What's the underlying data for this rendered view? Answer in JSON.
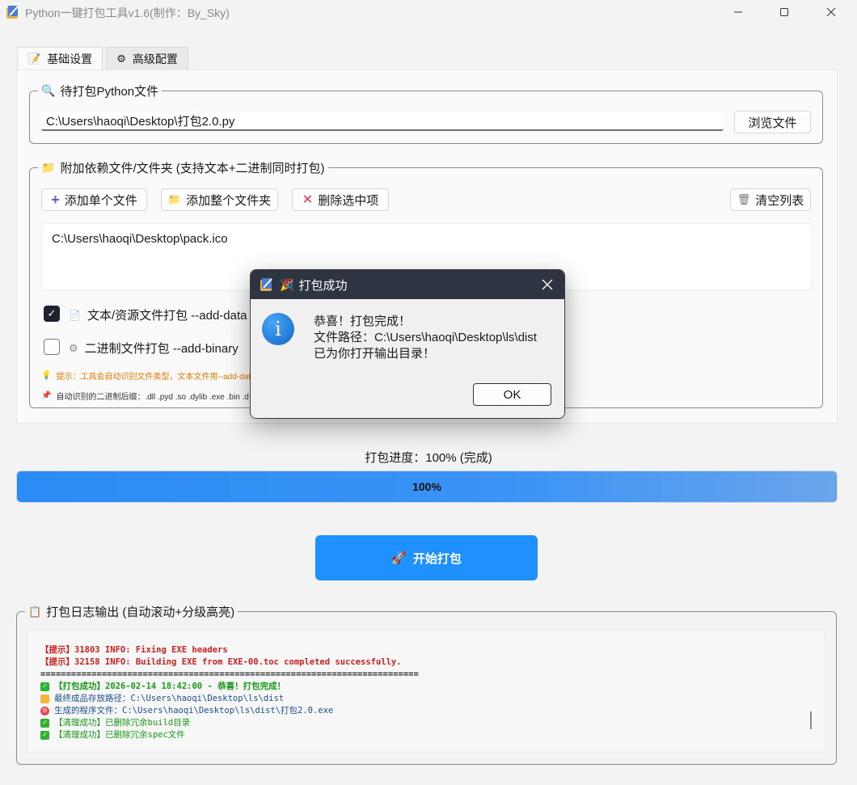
{
  "window": {
    "title": "Python一键打包工具v1.6(制作：By_Sky)",
    "minimize_icon": "minimize-icon",
    "maximize_icon": "maximize-icon",
    "close_icon": "close-icon"
  },
  "tabs": [
    {
      "label": "基础设置",
      "icon": "memo-icon",
      "active": true
    },
    {
      "label": "高级配置",
      "icon": "gear-icon",
      "active": false
    }
  ],
  "python_file": {
    "legend": "待打包Python文件",
    "path_value": "C:\\Users\\haoqi\\Desktop\\打包2.0.py",
    "browse_label": "浏览文件"
  },
  "deps": {
    "legend": "附加依赖文件/文件夹 (支持文本+二进制同时打包)",
    "add_file_label": "添加单个文件",
    "add_folder_label": "添加整个文件夹",
    "delete_label": "删除选中项",
    "clear_label": "清空列表",
    "files": [
      "C:\\Users\\haoqi\\Desktop\\pack.ico"
    ],
    "text_mode": {
      "label": "文本/资源文件打包 --add-data",
      "checked": true
    },
    "binary_mode": {
      "label": "二进制文件打包 --add-binary",
      "checked": false
    },
    "hint1": "提示：工具会自动识别文件类型，文本文件用--add-data",
    "hint2": "自动识别的二进制后缀：.dll .pyd .so .dylib .exe .bin .d"
  },
  "progress": {
    "label": "打包进度：100% (完成)",
    "value": 100,
    "text": "100%"
  },
  "start_button": {
    "label": "开始打包",
    "icon": "rocket-icon"
  },
  "log": {
    "legend": "打包日志输出 (自动滚动+分级高亮)",
    "lines": [
      {
        "text": "【提示】31803 INFO: Fixing EXE headers",
        "style": "red"
      },
      {
        "text": "【提示】32158 INFO: Building EXE from EXE-00.toc completed successfully.",
        "style": "red"
      },
      {
        "text": "==========================================================================",
        "style": "sep"
      },
      {
        "text": "【打包成功】2026-02-14 18:42:00 - 恭喜！打包完成！",
        "style": "green bold",
        "icon": "check-icon"
      },
      {
        "text": "最终成品存放路径：C:\\Users\\haoqi\\Desktop\\ls\\dist",
        "style": "blue",
        "icon": "folder-icon"
      },
      {
        "text": "生成的程序文件：C:\\Users\\haoqi\\Desktop\\ls\\dist\\打包2.0.exe",
        "style": "blue",
        "icon": "target-icon"
      },
      {
        "text": "【清理成功】已删除冗余build目录",
        "style": "green",
        "icon": "check-icon"
      },
      {
        "text": "【清理成功】已删除冗余spec文件",
        "style": "green",
        "icon": "check-icon"
      }
    ]
  },
  "dialog": {
    "title": "打包成功",
    "line1": "恭喜！打包完成！",
    "line2": "文件路径：C:\\Users\\haoqi\\Desktop\\ls\\dist",
    "line3": "已为你打开输出目录！",
    "ok_label": "OK"
  },
  "colors": {
    "accent": "#1e90ff",
    "dialog_header": "#2e3441",
    "log_error": "#cc1f1f",
    "log_success": "#1a9a1a",
    "log_info": "#1d4f91"
  }
}
